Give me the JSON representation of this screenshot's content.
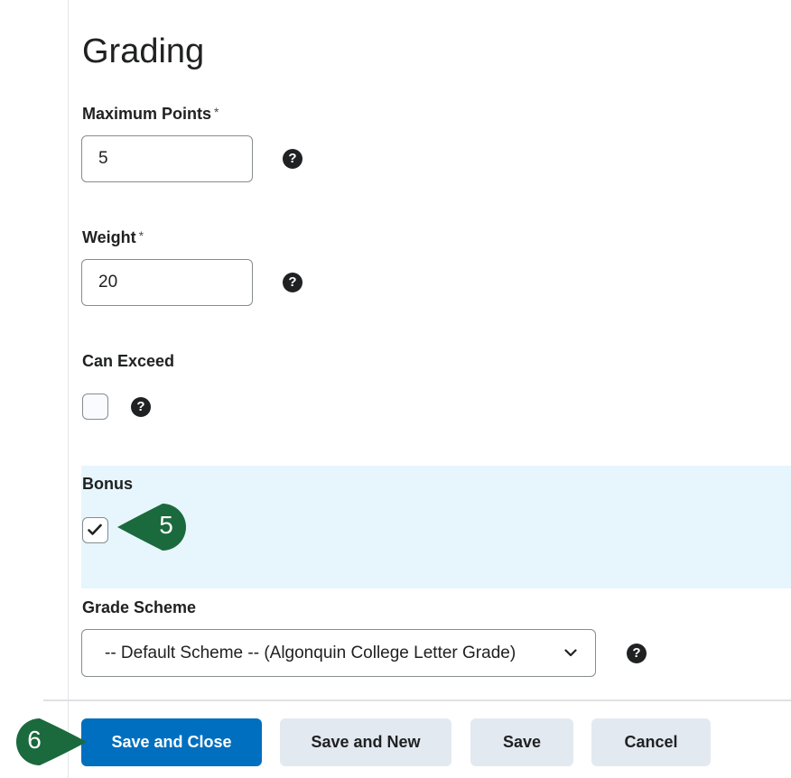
{
  "section": {
    "title": "Grading"
  },
  "max_points": {
    "label": "Maximum Points",
    "required_mark": "*",
    "value": "5"
  },
  "weight": {
    "label": "Weight",
    "required_mark": "*",
    "value": "20"
  },
  "can_exceed": {
    "label": "Can Exceed",
    "checked": false
  },
  "bonus": {
    "label": "Bonus",
    "checked": true
  },
  "grade_scheme": {
    "label": "Grade Scheme",
    "selected": "-- Default Scheme -- (Algonquin College Letter Grade)"
  },
  "help_icon_glyph": "?",
  "callouts": {
    "bonus_step": "5",
    "save_step": "6",
    "color": "#1a6a3d"
  },
  "footer": {
    "save_close": "Save and Close",
    "save_new": "Save and New",
    "save": "Save",
    "cancel": "Cancel"
  },
  "colors": {
    "primary": "#006fbf",
    "highlight": "#e7f6fd",
    "callout": "#1a6a3d"
  }
}
